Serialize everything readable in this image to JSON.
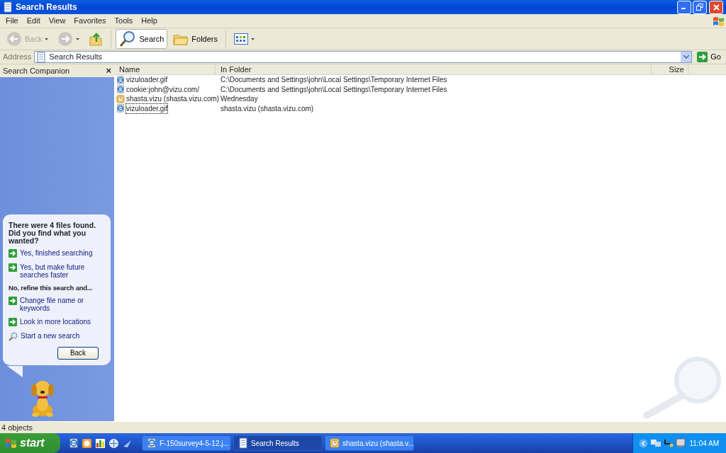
{
  "window": {
    "title": "Search Results"
  },
  "menu": [
    "File",
    "Edit",
    "View",
    "Favorites",
    "Tools",
    "Help"
  ],
  "toolbar": {
    "back": {
      "label": "Back",
      "disabled": true
    },
    "forward": {
      "disabled": true
    },
    "buttons": [
      {
        "label": "Search",
        "kind": "search",
        "selected": true
      },
      {
        "label": "Folders",
        "kind": "folders",
        "selected": false
      }
    ]
  },
  "address": {
    "label": "Address",
    "value": "Search Results",
    "go": "Go"
  },
  "sidebar": {
    "title": "Search Companion",
    "close": "×",
    "message": "There were 4 files found. Did you find what you wanted?",
    "items": [
      {
        "kind": "arrow",
        "label": "Yes, finished searching"
      },
      {
        "kind": "arrow",
        "label": "Yes, but make future searches faster"
      },
      {
        "kind": "heading",
        "label": "No, refine this search and..."
      },
      {
        "kind": "arrow",
        "label": "Change file name or keywords"
      },
      {
        "kind": "arrow",
        "label": "Look in more locations"
      },
      {
        "kind": "search",
        "label": "Start a new search"
      }
    ],
    "back": "Back"
  },
  "table": {
    "columns": [
      "Name",
      "In Folder",
      "Size"
    ],
    "rows": [
      {
        "kind": "ie",
        "name": "vizuloader.gif",
        "folder": "C:\\Documents and Settings\\john\\Local Settings\\Temporary Internet Files",
        "focused": false
      },
      {
        "kind": "ie",
        "name": "cookie:john@vizu.com/",
        "folder": "C:\\Documents and Settings\\john\\Local Settings\\Temporary Internet Files",
        "focused": false
      },
      {
        "kind": "history",
        "name": "shasta.vizu (shasta.vizu.com)",
        "folder": "Wednesday",
        "focused": false
      },
      {
        "kind": "ie",
        "name": "vizuloader.gif",
        "folder": "shasta.vizu (shasta.vizu.com)",
        "focused": true
      }
    ]
  },
  "status_bar": "4 objects",
  "taskbar": {
    "start": "start",
    "tasks": [
      {
        "kind": "ie",
        "label": "F-150survey4-5-12.j...",
        "selected": false
      },
      {
        "kind": "page",
        "label": "Search Results",
        "selected": true
      },
      {
        "kind": "history",
        "label": "shasta.vizu (shasta.v...",
        "selected": false
      }
    ],
    "clock": "11:04 AM"
  }
}
